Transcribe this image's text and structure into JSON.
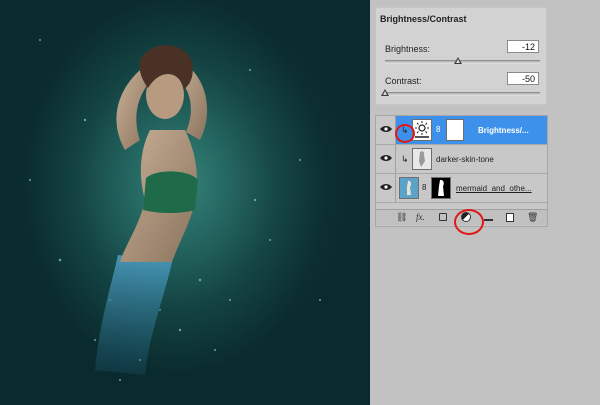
{
  "adjustments": {
    "title": "Brightness/Contrast",
    "brightness": {
      "label": "Brightness:",
      "value": "-12",
      "level_percent": 47
    },
    "contrast": {
      "label": "Contrast:",
      "value": "-50",
      "level_percent": 0
    }
  },
  "layers": [
    {
      "name": "Brightness/...",
      "selected": true,
      "visible": true,
      "clipped": true
    },
    {
      "name": "darker-skin-tone",
      "selected": false,
      "visible": true,
      "clipped": true
    },
    {
      "name": "mermaid_and_othe...",
      "selected": false,
      "visible": true,
      "clipped": false
    }
  ],
  "toolbar": {
    "icons": [
      "link-icon",
      "fx-icon",
      "add-mask-icon",
      "new-adjustment-layer-icon",
      "new-group-icon",
      "new-layer-icon",
      "trash-icon"
    ],
    "fx_label": "fx."
  },
  "colors": {
    "selection": "#3d91ea",
    "annotation": "#e01818",
    "canvas_bg": "#0f3b3c"
  }
}
